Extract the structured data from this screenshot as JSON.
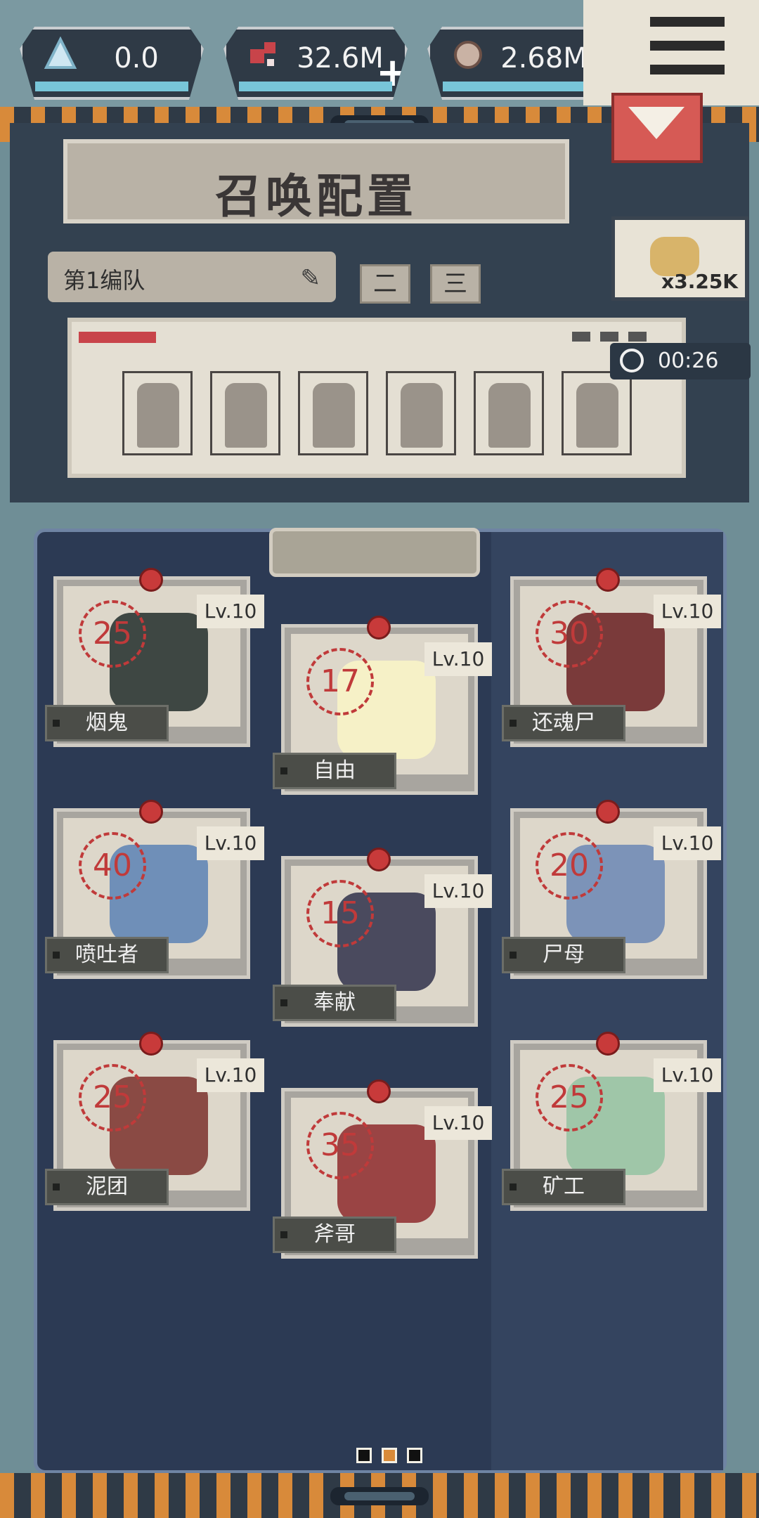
{
  "resources": [
    {
      "icon": "crystal-icon",
      "value": "0.0",
      "has_plus": false
    },
    {
      "icon": "flesh-chunk-icon",
      "value": "32.6M",
      "has_plus": true
    },
    {
      "icon": "stone-egg-icon",
      "value": "2.68M",
      "has_plus": true
    }
  ],
  "header": {
    "title": "召唤配置"
  },
  "team": {
    "name": "第1编队",
    "tabs": [
      "二",
      "三"
    ]
  },
  "reward": {
    "multiplier": "x3.25K"
  },
  "timer": {
    "value": "00:26"
  },
  "cards": [
    {
      "cost": "25",
      "level": "Lv.10",
      "name": "烟鬼"
    },
    {
      "cost": "17",
      "level": "Lv.10",
      "name": "自由"
    },
    {
      "cost": "30",
      "level": "Lv.10",
      "name": "还魂尸"
    },
    {
      "cost": "40",
      "level": "Lv.10",
      "name": "喷吐者"
    },
    {
      "cost": "15",
      "level": "Lv.10",
      "name": "奉献"
    },
    {
      "cost": "20",
      "level": "Lv.10",
      "name": "尸母"
    },
    {
      "cost": "25",
      "level": "Lv.10",
      "name": "泥团"
    },
    {
      "cost": "35",
      "level": "Lv.10",
      "name": "斧哥"
    },
    {
      "cost": "25",
      "level": "Lv.10",
      "name": "矿工"
    }
  ],
  "pager": {
    "count": 3,
    "active": 1
  },
  "colors": {
    "accent": "#d88a3a",
    "danger": "#d65a55",
    "board": "#2c3a54"
  }
}
